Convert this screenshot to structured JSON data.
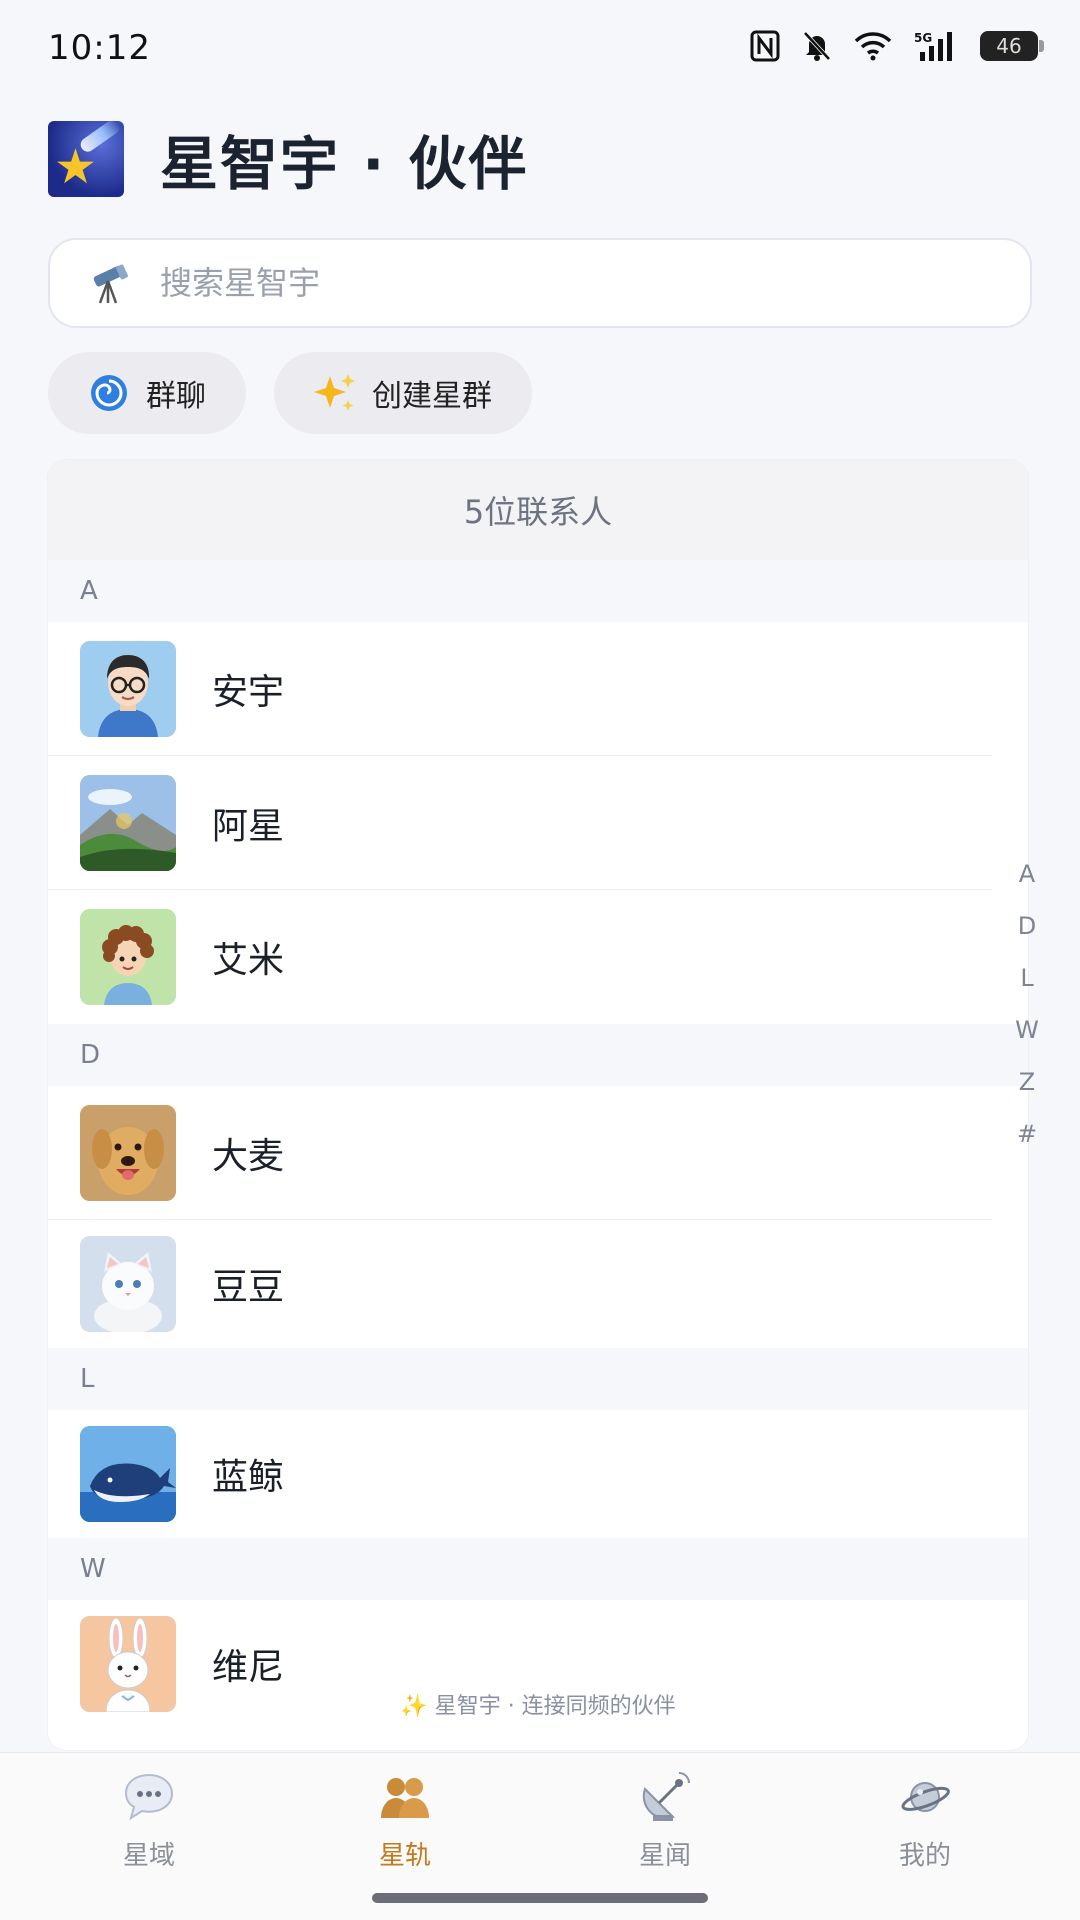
{
  "status_bar": {
    "time": "10:12",
    "icons": [
      "nfc-icon",
      "bell-muted-icon",
      "wifi-icon",
      "signal-5g-icon",
      "battery-icon"
    ],
    "battery": "46",
    "network": "5G"
  },
  "header": {
    "logo": "shooting-star-icon",
    "title": "星智宇 · 伙伴"
  },
  "search": {
    "icon": "telescope-icon",
    "placeholder": "搜索星智宇"
  },
  "quick_actions": [
    {
      "icon": "cyclone-icon",
      "label": "群聊"
    },
    {
      "icon": "sparkles-icon",
      "label": "创建星群"
    }
  ],
  "contacts": {
    "count_label": "5位联系人",
    "sections": [
      {
        "letter": "A",
        "items": [
          {
            "name": "安宇"
          },
          {
            "name": "阿星"
          },
          {
            "name": "艾米"
          }
        ]
      },
      {
        "letter": "D",
        "items": [
          {
            "name": "大麦"
          },
          {
            "name": "豆豆"
          }
        ]
      },
      {
        "letter": "L",
        "items": [
          {
            "name": "蓝鲸"
          }
        ]
      },
      {
        "letter": "W",
        "items": [
          {
            "name": "维尼"
          }
        ]
      }
    ],
    "footer": "✨ 星智宇 · 连接同频的伙伴"
  },
  "alpha_index": [
    "A",
    "D",
    "L",
    "W",
    "Z",
    "#"
  ],
  "bottom_nav": {
    "items": [
      {
        "label": "星域",
        "icon": "speech-bubble-icon",
        "active": false
      },
      {
        "label": "星轨",
        "icon": "people-icon",
        "active": true
      },
      {
        "label": "星闻",
        "icon": "satellite-dish-icon",
        "active": false
      },
      {
        "label": "我的",
        "icon": "planet-icon",
        "active": false
      }
    ],
    "active_color": "#c47a1a"
  }
}
